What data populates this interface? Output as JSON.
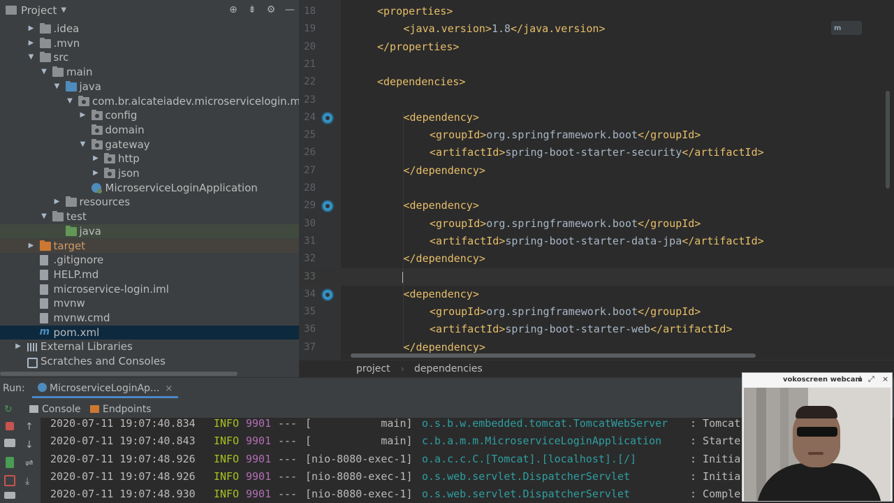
{
  "project_panel": {
    "title": "Project",
    "tree": [
      {
        "label": ".idea",
        "depth": 1,
        "arrow": "▶",
        "icon": "folder"
      },
      {
        "label": ".mvn",
        "depth": 1,
        "arrow": "▶",
        "icon": "folder"
      },
      {
        "label": "src",
        "depth": 1,
        "arrow": "▼",
        "icon": "folder"
      },
      {
        "label": "main",
        "depth": 2,
        "arrow": "▼",
        "icon": "folder"
      },
      {
        "label": "java",
        "depth": 3,
        "arrow": "▼",
        "icon": "folder-blue"
      },
      {
        "label": "com.br.alcateiadev.microservicelogin.microse",
        "depth": 4,
        "arrow": "▼",
        "icon": "package"
      },
      {
        "label": "config",
        "depth": 5,
        "arrow": "▶",
        "icon": "package"
      },
      {
        "label": "domain",
        "depth": 5,
        "arrow": "",
        "icon": "package"
      },
      {
        "label": "gateway",
        "depth": 5,
        "arrow": "▼",
        "icon": "package"
      },
      {
        "label": "http",
        "depth": 6,
        "arrow": "▶",
        "icon": "package"
      },
      {
        "label": "json",
        "depth": 6,
        "arrow": "▶",
        "icon": "package"
      },
      {
        "label": "MicroserviceLoginApplication",
        "depth": 5,
        "arrow": "",
        "icon": "spring-class"
      },
      {
        "label": "resources",
        "depth": 3,
        "arrow": "▶",
        "icon": "folder"
      },
      {
        "label": "test",
        "depth": 2,
        "arrow": "▼",
        "icon": "folder"
      },
      {
        "label": "java",
        "depth": 3,
        "arrow": "",
        "icon": "folder-green"
      },
      {
        "label": "target",
        "depth": 1,
        "arrow": "▶",
        "icon": "folder-orange"
      },
      {
        "label": ".gitignore",
        "depth": 1,
        "arrow": "",
        "icon": "file"
      },
      {
        "label": "HELP.md",
        "depth": 1,
        "arrow": "",
        "icon": "file"
      },
      {
        "label": "microservice-login.iml",
        "depth": 1,
        "arrow": "",
        "icon": "file"
      },
      {
        "label": "mvnw",
        "depth": 1,
        "arrow": "",
        "icon": "file"
      },
      {
        "label": "mvnw.cmd",
        "depth": 1,
        "arrow": "",
        "icon": "file"
      },
      {
        "label": "pom.xml",
        "depth": 1,
        "arrow": "",
        "icon": "maven"
      },
      {
        "label": "External Libraries",
        "depth": 0,
        "arrow": "▶",
        "icon": "library"
      },
      {
        "label": "Scratches and Consoles",
        "depth": 0,
        "arrow": "",
        "icon": "scratch"
      }
    ]
  },
  "editor": {
    "badge": "m",
    "caret_line": "33",
    "lines": [
      {
        "num": "18",
        "indent": 0,
        "parts": [
          [
            "tag",
            "<properties>"
          ]
        ]
      },
      {
        "num": "19",
        "indent": 1,
        "parts": [
          [
            "tag",
            "<java.version>"
          ],
          [
            "txt",
            "1.8"
          ],
          [
            "tag",
            "</java.version>"
          ]
        ]
      },
      {
        "num": "20",
        "indent": 0,
        "parts": [
          [
            "tag",
            "</properties>"
          ]
        ]
      },
      {
        "num": "21",
        "indent": 0,
        "parts": []
      },
      {
        "num": "22",
        "indent": 0,
        "parts": [
          [
            "tag",
            "<dependencies>"
          ]
        ]
      },
      {
        "num": "23",
        "indent": 0,
        "parts": []
      },
      {
        "num": "24",
        "indent": 1,
        "parts": [
          [
            "tag",
            "<dependency>"
          ]
        ],
        "gutter_icon": "maven-dependency-icon"
      },
      {
        "num": "25",
        "indent": 2,
        "parts": [
          [
            "tag",
            "<groupId>"
          ],
          [
            "txt",
            "org.springframework.boot"
          ],
          [
            "tag",
            "</groupId>"
          ]
        ]
      },
      {
        "num": "26",
        "indent": 2,
        "parts": [
          [
            "tag",
            "<artifactId>"
          ],
          [
            "txt",
            "spring-boot-starter-security"
          ],
          [
            "tag",
            "</artifactId>"
          ]
        ]
      },
      {
        "num": "27",
        "indent": 1,
        "parts": [
          [
            "tag",
            "</dependency>"
          ]
        ]
      },
      {
        "num": "28",
        "indent": 0,
        "parts": []
      },
      {
        "num": "29",
        "indent": 1,
        "parts": [
          [
            "tag",
            "<dependency>"
          ]
        ],
        "gutter_icon": "maven-dependency-icon"
      },
      {
        "num": "30",
        "indent": 2,
        "parts": [
          [
            "tag",
            "<groupId>"
          ],
          [
            "txt",
            "org.springframework.boot"
          ],
          [
            "tag",
            "</groupId>"
          ]
        ]
      },
      {
        "num": "31",
        "indent": 2,
        "parts": [
          [
            "tag",
            "<artifactId>"
          ],
          [
            "txt",
            "spring-boot-starter-data-jpa"
          ],
          [
            "tag",
            "</artifactId>"
          ]
        ]
      },
      {
        "num": "32",
        "indent": 1,
        "parts": [
          [
            "tag",
            "</dependency>"
          ]
        ]
      },
      {
        "num": "33",
        "indent": 0,
        "parts": []
      },
      {
        "num": "34",
        "indent": 1,
        "parts": [
          [
            "tag",
            "<dependency>"
          ]
        ],
        "gutter_icon": "maven-dependency-icon"
      },
      {
        "num": "35",
        "indent": 2,
        "parts": [
          [
            "tag",
            "<groupId>"
          ],
          [
            "txt",
            "org.springframework.boot"
          ],
          [
            "tag",
            "</groupId>"
          ]
        ]
      },
      {
        "num": "36",
        "indent": 2,
        "parts": [
          [
            "tag",
            "<artifactId>"
          ],
          [
            "txt",
            "spring-boot-starter-web"
          ],
          [
            "tag",
            "</artifactId>"
          ]
        ]
      },
      {
        "num": "37",
        "indent": 1,
        "parts": [
          [
            "tag",
            "</dependency>"
          ]
        ]
      }
    ],
    "breadcrumb": [
      "project",
      "dependencies"
    ]
  },
  "run_panel": {
    "label": "Run:",
    "tab_label": "MicroserviceLoginAp...",
    "subtabs": [
      "Console",
      "Endpoints"
    ],
    "log": [
      {
        "ts": "2020-07-11 19:07:40.834",
        "level": "INFO",
        "pid": "9901",
        "sep": "---",
        "thread": "[           main]",
        "logger": "o.s.b.w.embedded.tomcat.TomcatWebServer",
        "msg": ": Tomcat"
      },
      {
        "ts": "2020-07-11 19:07:40.843",
        "level": "INFO",
        "pid": "9901",
        "sep": "---",
        "thread": "[           main]",
        "logger": "c.b.a.m.m.MicroserviceLoginApplication",
        "msg": ": Starte"
      },
      {
        "ts": "2020-07-11 19:07:48.926",
        "level": "INFO",
        "pid": "9901",
        "sep": "---",
        "thread": "[nio-8080-exec-1]",
        "logger": "o.a.c.c.C.[Tomcat].[localhost].[/]",
        "msg": ": Initia"
      },
      {
        "ts": "2020-07-11 19:07:48.926",
        "level": "INFO",
        "pid": "9901",
        "sep": "---",
        "thread": "[nio-8080-exec-1]",
        "logger": "o.s.web.servlet.DispatcherServlet",
        "msg": ": Initia"
      },
      {
        "ts": "2020-07-11 19:07:48.930",
        "level": "INFO",
        "pid": "9901",
        "sep": "---",
        "thread": "[nio-8080-exec-1]",
        "logger": "o.s.web.servlet.DispatcherServlet",
        "msg": ": Comple"
      }
    ]
  },
  "webcam": {
    "title": "vokoscreen webcam"
  }
}
